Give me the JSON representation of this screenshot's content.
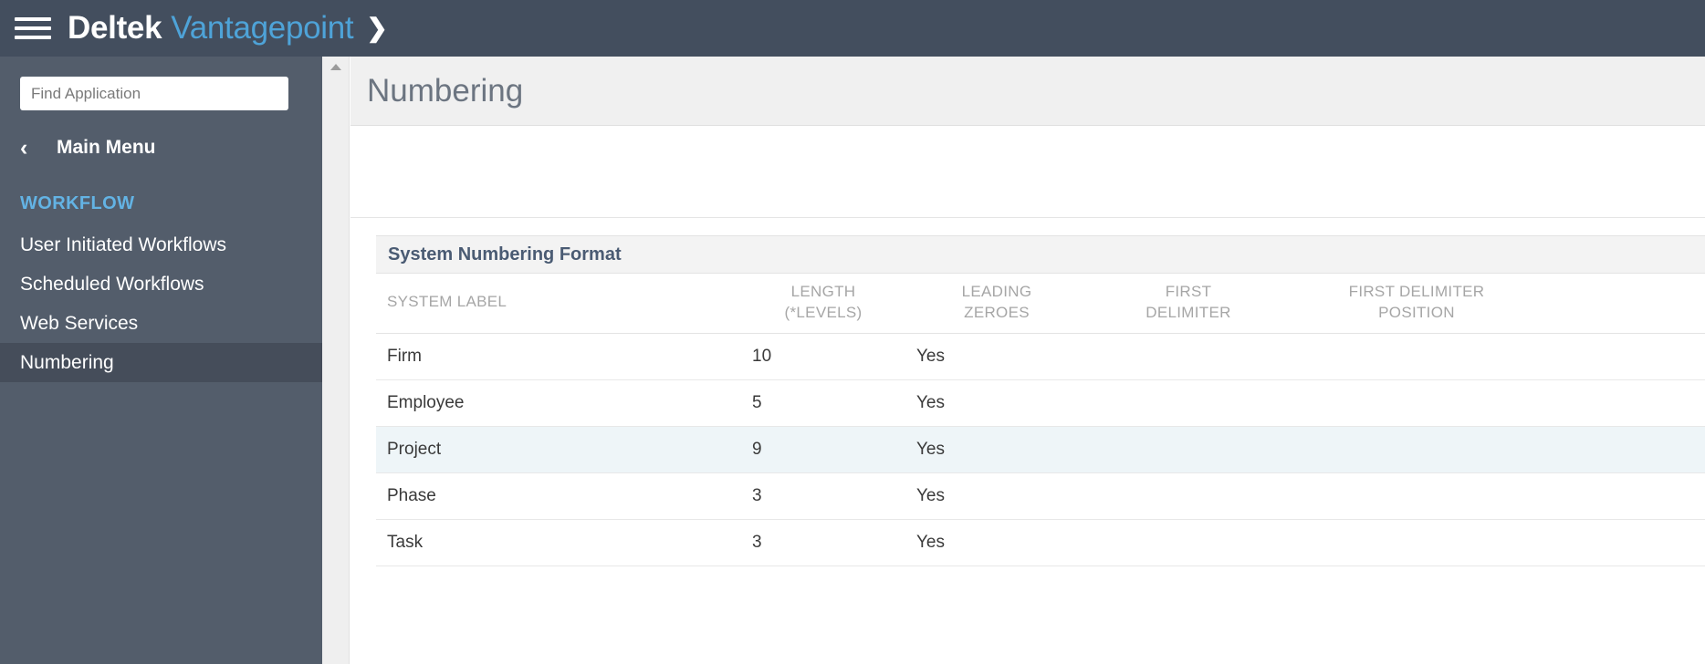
{
  "topbar": {
    "menu_icon": "hamburger-icon",
    "brand_primary": "Deltek",
    "brand_secondary": "Vantagepoint",
    "brand_chevron": "❯"
  },
  "sidebar": {
    "search": {
      "placeholder": "Find Application",
      "value": ""
    },
    "back": {
      "icon": "chevron-left-icon",
      "glyph": "‹",
      "label": "Main Menu"
    },
    "section_label": "WORKFLOW",
    "items": [
      {
        "label": "User Initiated Workflows",
        "selected": false
      },
      {
        "label": "Scheduled Workflows",
        "selected": false
      },
      {
        "label": "Web Services",
        "selected": false
      },
      {
        "label": "Numbering",
        "selected": true
      }
    ]
  },
  "gutter": {
    "scroll_up_icon": "triangle-up-icon"
  },
  "main": {
    "page_title": "Numbering",
    "card": {
      "title": "System Numbering Format",
      "columns": [
        {
          "key": "system_label",
          "line1": "SYSTEM LABEL",
          "line2": ""
        },
        {
          "key": "length",
          "line1": "LENGTH",
          "line2": "(*LEVELS)"
        },
        {
          "key": "leading_zeroes",
          "line1": "LEADING",
          "line2": "ZEROES"
        },
        {
          "key": "first_delimiter",
          "line1": "FIRST",
          "line2": "DELIMITER"
        },
        {
          "key": "first_delimiter_position",
          "line1": "FIRST DELIMITER",
          "line2": "POSITION"
        }
      ],
      "rows": [
        {
          "system_label": "Firm",
          "length": "10",
          "leading_zeroes": "Yes",
          "first_delimiter": "",
          "first_delimiter_position": "",
          "selected": false
        },
        {
          "system_label": "Employee",
          "length": "5",
          "leading_zeroes": "Yes",
          "first_delimiter": "",
          "first_delimiter_position": "",
          "selected": false
        },
        {
          "system_label": "Project",
          "length": "9",
          "leading_zeroes": "Yes",
          "first_delimiter": "",
          "first_delimiter_position": "",
          "selected": true
        },
        {
          "system_label": "Phase",
          "length": "3",
          "leading_zeroes": "Yes",
          "first_delimiter": "",
          "first_delimiter_position": "",
          "selected": false
        },
        {
          "system_label": "Task",
          "length": "3",
          "leading_zeroes": "Yes",
          "first_delimiter": "",
          "first_delimiter_position": "",
          "selected": false
        }
      ]
    }
  },
  "colors": {
    "header_bar": "#434e5e",
    "sidebar": "#535d6b",
    "sidebar_selected": "#454d5a",
    "brand_accent": "#4ea3d8",
    "section_accent": "#63b3e4",
    "card_title": "#4a5b73",
    "row_selected": "#eef5f8"
  }
}
